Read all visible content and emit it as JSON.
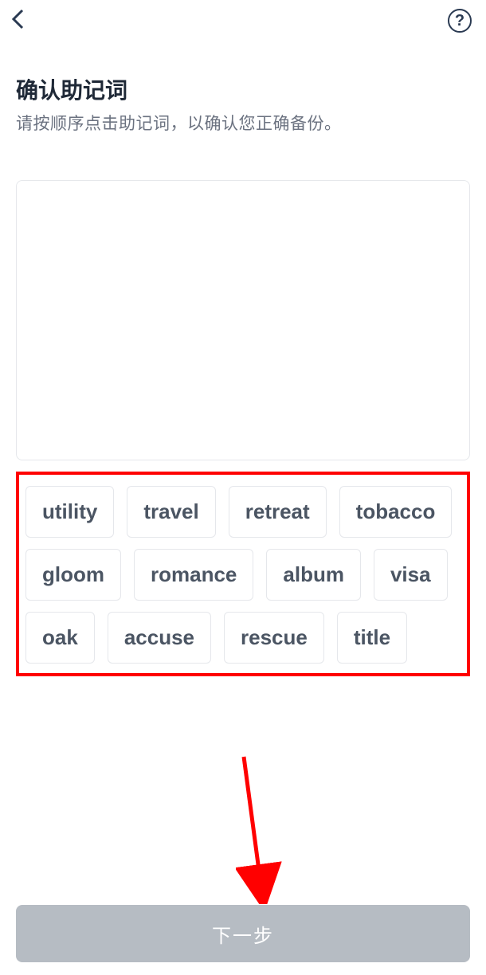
{
  "header": {
    "title": "确认助记词",
    "subtitle": "请按顺序点击助记词，以确认您正确备份。"
  },
  "words": [
    "utility",
    "travel",
    "retreat",
    "tobacco",
    "gloom",
    "romance",
    "album",
    "visa",
    "oak",
    "accuse",
    "rescue",
    "title"
  ],
  "next_button_label": "下一步"
}
